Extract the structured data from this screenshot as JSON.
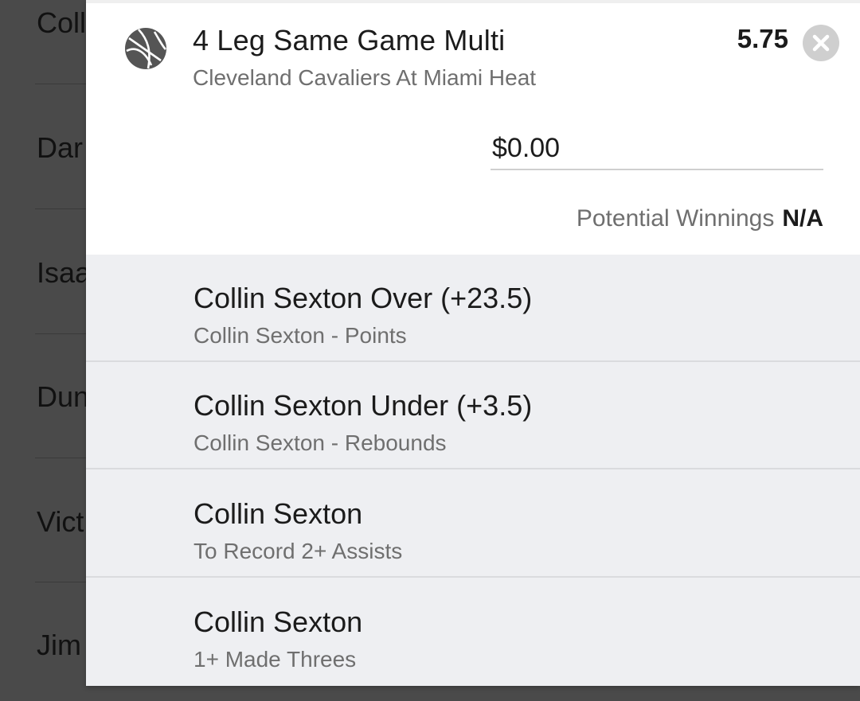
{
  "background_list": {
    "items": [
      "Coll",
      "Dar",
      "Isaa",
      "Dun",
      "Vict",
      "Jim"
    ]
  },
  "bet": {
    "icon": "basketball-icon",
    "title": "4 Leg Same Game Multi",
    "subtitle": "Cleveland Cavaliers At Miami Heat",
    "odds": "5.75",
    "close_icon": "close-icon",
    "stake_value": "$0.00",
    "potential_winnings_label": "Potential Winnings",
    "potential_winnings_value": "N/A"
  },
  "legs": [
    {
      "title": "Collin Sexton Over (+23.5)",
      "subtitle": "Collin Sexton - Points"
    },
    {
      "title": "Collin Sexton Under (+3.5)",
      "subtitle": "Collin Sexton - Rebounds"
    },
    {
      "title": "Collin Sexton",
      "subtitle": "To Record 2+ Assists"
    },
    {
      "title": "Collin Sexton",
      "subtitle": "1+ Made Threes"
    }
  ],
  "colors": {
    "overlay": "#4a4a4a",
    "panel": "#ffffff",
    "legs_bg": "#eeeff2",
    "primary_text": "#1b1b1b",
    "secondary_text": "#6f6f6f",
    "close_button": "#cfcfcf"
  }
}
